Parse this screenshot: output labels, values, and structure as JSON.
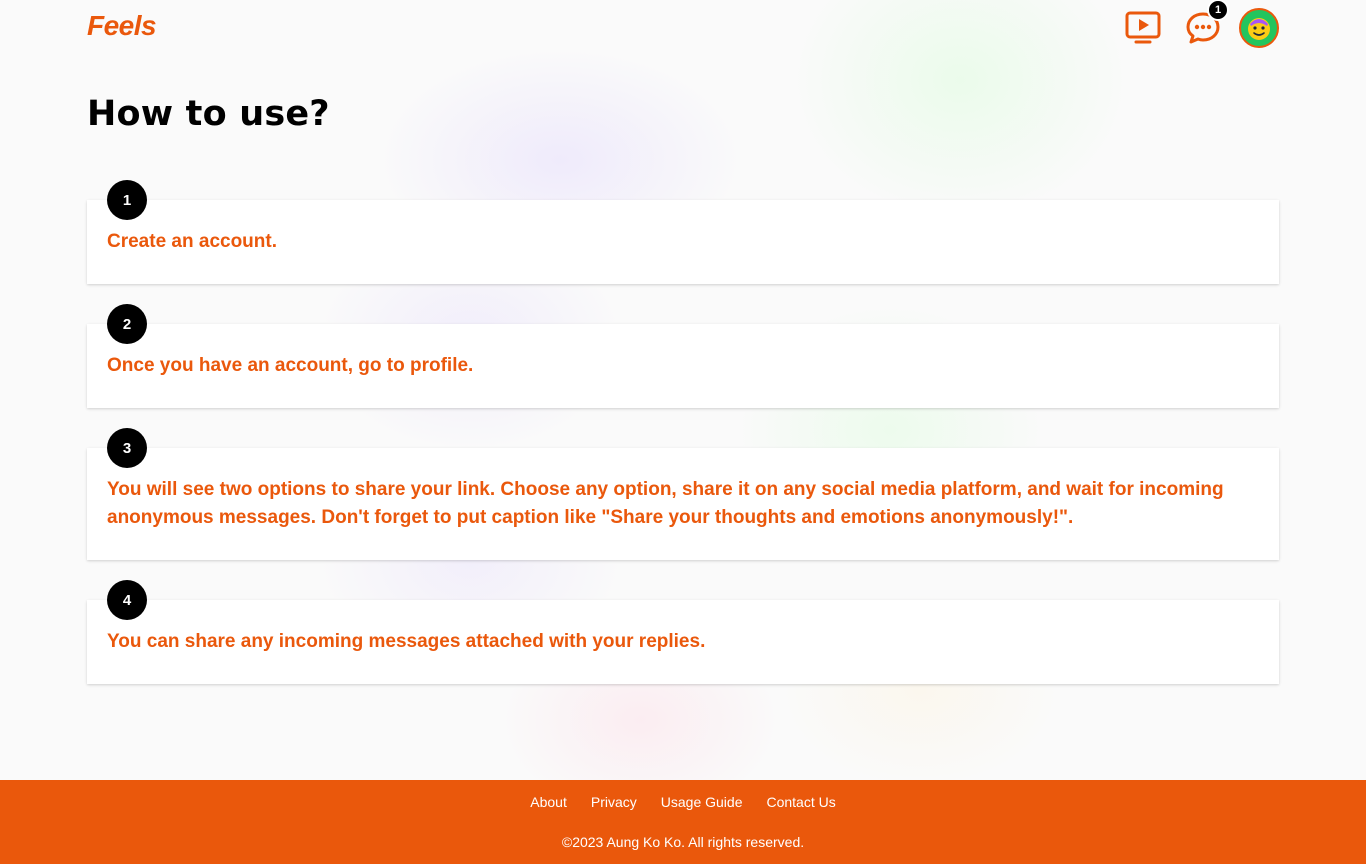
{
  "header": {
    "logo": "Feels",
    "notification_count": "1",
    "icons": {
      "watch": "tv-play-icon",
      "messages": "chat-bubble-icon",
      "avatar": "emoji-avatar"
    }
  },
  "main": {
    "title": "How to use?",
    "steps": [
      {
        "number": "1",
        "text": "Create an account."
      },
      {
        "number": "2",
        "text": "Once you have an account, go to profile."
      },
      {
        "number": "3",
        "text": "You will see two options to share your link. Choose any option, share it on any social media platform, and wait for incoming anonymous messages. Don't forget to put caption like \"Share your thoughts and emotions anonymously!\"."
      },
      {
        "number": "4",
        "text": "You can share any incoming messages attached with your replies."
      }
    ]
  },
  "footer": {
    "links": [
      "About",
      "Privacy",
      "Usage Guide",
      "Contact Us"
    ],
    "copyright": "©2023 Aung Ko Ko. All rights reserved."
  },
  "colors": {
    "accent": "#ea580c",
    "badge": "#000000",
    "background": "#fafafa"
  }
}
